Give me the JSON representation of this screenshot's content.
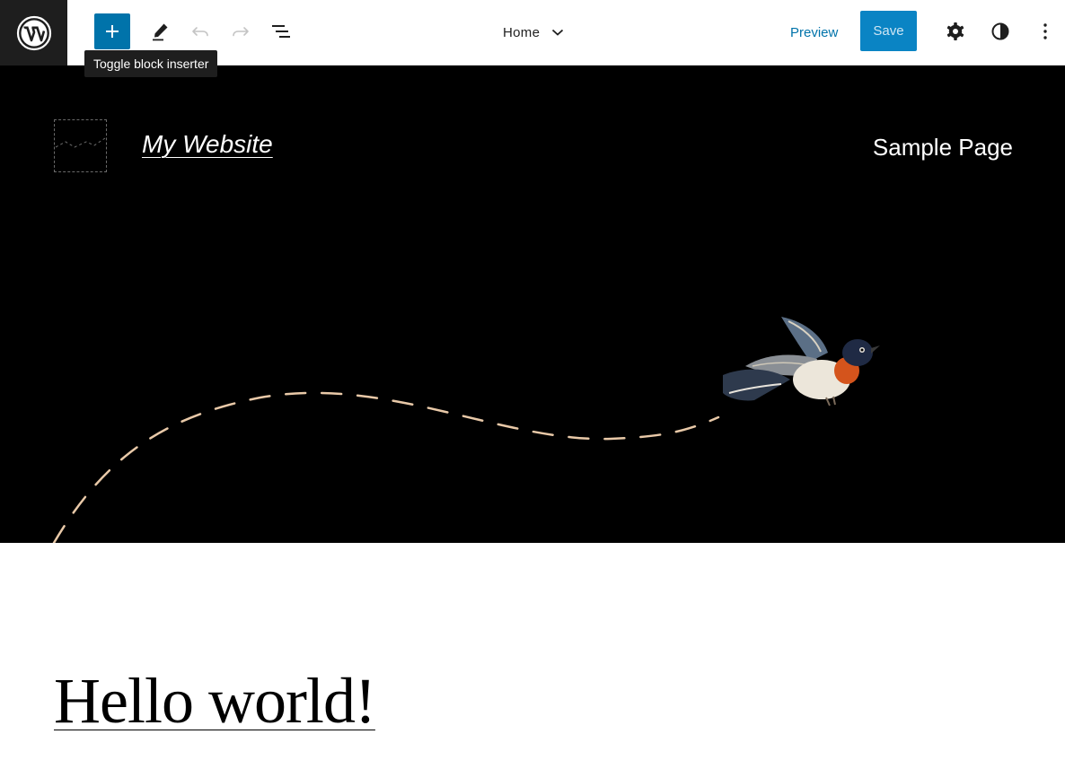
{
  "toolbar": {
    "wp_logo_icon": "wordpress-icon",
    "inserter_icon": "plus-icon",
    "tools_icon": "pencil-icon",
    "undo_icon": "undo-icon",
    "redo_icon": "redo-icon",
    "list_view_icon": "list-view-icon",
    "tooltip": "Toggle block inserter",
    "document_title": "Home",
    "document_title_icon": "chevron-down-icon",
    "preview_label": "Preview",
    "save_label": "Save",
    "settings_icon": "gear-icon",
    "styles_icon": "half-circle-contrast-icon",
    "options_icon": "vertical-ellipsis-icon"
  },
  "canvas": {
    "site_title": "My Website",
    "nav_link": "Sample Page",
    "header_illustration": "bird-with-dashed-flight-path",
    "post_title": "Hello world!"
  },
  "colors": {
    "accent": "#0073aa",
    "save_button": "#0a84c4",
    "toolbar_dark": "#1e1e1e",
    "header_background": "#000000",
    "flight_path": "#e9c9a8"
  }
}
